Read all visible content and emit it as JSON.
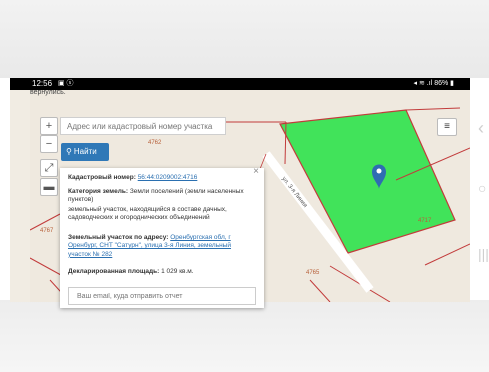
{
  "status_bar": {
    "time": "12:56",
    "icons_left": "▣ ⓢ",
    "right": "◂ ≋ .ıl 86% ▮"
  },
  "page_top_cut": "вернулись.",
  "map": {
    "search_placeholder": "Адрес или кадастровый номер участка",
    "find_button": "Найти",
    "zoom_in": "+",
    "zoom_out": "−",
    "plot_labels": [
      "4762",
      "4717",
      "4765",
      "4767"
    ],
    "street_label": "ул. 3-я Линия"
  },
  "popup": {
    "close": "×",
    "cadastral_label": "Кадастровый номер:",
    "cadastral_value": "56:44:0209002:4716",
    "category_label": "Категория земель:",
    "category_value": "Земли поселений (земли населенных пунктов)",
    "use_text": "земельный участок, находящийся в составе дачных, садоводческих и огороднических объединений",
    "address_label": "Земельный участок по адресу:",
    "address_value": "Оренбургская обл, г Оренбург, СНТ \"Сатурн\", улица 3-я Линия, земельный участок № 282",
    "area_label": "Декларированная площадь:",
    "area_value": "1 029 кв.м.",
    "email_placeholder": "Ваш email, куда отправить отчет"
  },
  "colors": {
    "parcel_fill": "#2ee24b",
    "button_blue": "#2f78b7",
    "marker_blue": "#2f6cb3",
    "boundary": "#c23b3b"
  },
  "ghost_icons": [
    "chevron-left-icon",
    "circle-icon",
    "recent-apps-icon"
  ]
}
